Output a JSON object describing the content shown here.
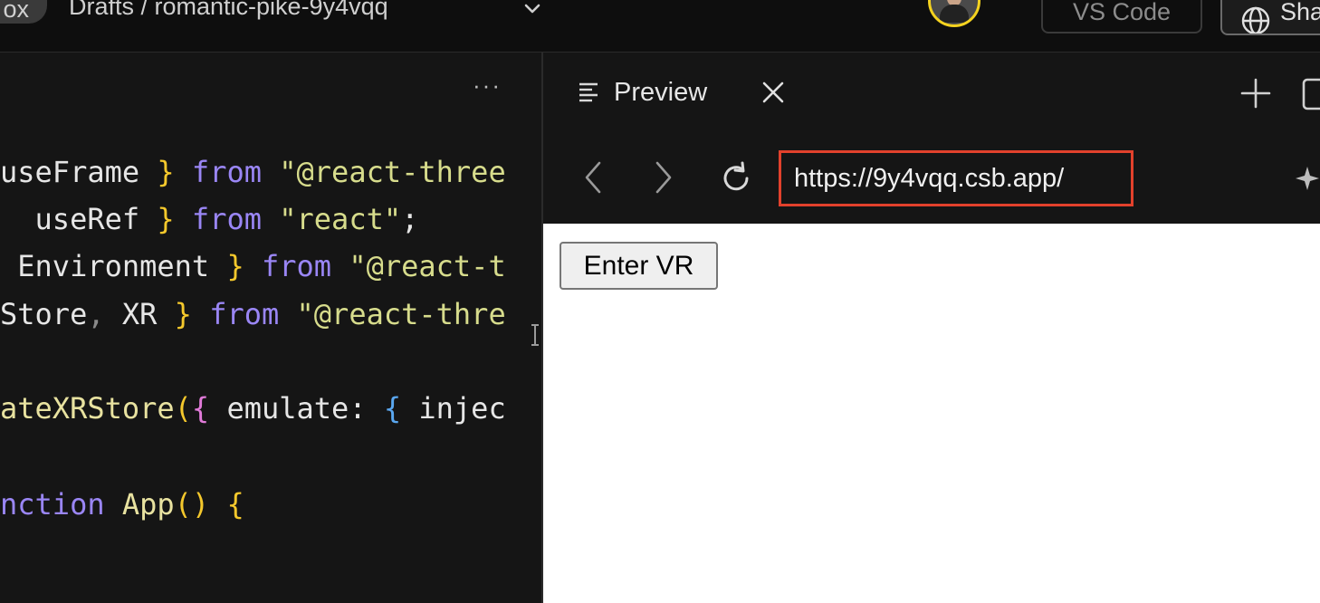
{
  "topbar": {
    "brand_fragment": "ox",
    "breadcrumb": "Drafts / romantic-pike-9y4vqq",
    "vscode_label": "VS Code",
    "share_label": "Share"
  },
  "editor": {
    "more_label": "···",
    "lines": [
      [
        {
          "t": "useFrame ",
          "c": ""
        },
        {
          "t": "}",
          "c": "br"
        },
        {
          "t": " from ",
          "c": "kw"
        },
        {
          "t": "\"@react-three",
          "c": "str"
        }
      ],
      [
        {
          "t": "  useRef ",
          "c": ""
        },
        {
          "t": "}",
          "c": "br"
        },
        {
          "t": " from ",
          "c": "kw"
        },
        {
          "t": "\"react\"",
          "c": "str"
        },
        {
          "t": ";",
          "c": ""
        }
      ],
      [
        {
          "t": " Environment ",
          "c": ""
        },
        {
          "t": "}",
          "c": "br"
        },
        {
          "t": " from ",
          "c": "kw"
        },
        {
          "t": "\"@react-t",
          "c": "str"
        }
      ],
      [
        {
          "t": "Store",
          "c": ""
        },
        {
          "t": ",",
          "c": "punc"
        },
        {
          "t": " XR ",
          "c": ""
        },
        {
          "t": "}",
          "c": "br"
        },
        {
          "t": " from ",
          "c": "kw"
        },
        {
          "t": "\"@react-thre",
          "c": "str"
        }
      ],
      [],
      [
        {
          "t": "ateXRStore",
          "c": "fn"
        },
        {
          "t": "(",
          "c": "br"
        },
        {
          "t": "{",
          "c": "br2"
        },
        {
          "t": " emulate: ",
          "c": ""
        },
        {
          "t": "{",
          "c": "br3"
        },
        {
          "t": " injec",
          "c": ""
        }
      ],
      [],
      [
        {
          "t": "nction ",
          "c": "kw"
        },
        {
          "t": "App",
          "c": "fn"
        },
        {
          "t": "()",
          "c": "br"
        },
        {
          "t": " ",
          "c": ""
        },
        {
          "t": "{",
          "c": "br"
        }
      ]
    ]
  },
  "preview": {
    "tab_label": "Preview",
    "url": "https://9y4vqq.csb.app/",
    "button_label": "Enter VR"
  },
  "colors": {
    "accent_highlight": "#e2412c",
    "avatar_ring": "#f4d21f"
  }
}
